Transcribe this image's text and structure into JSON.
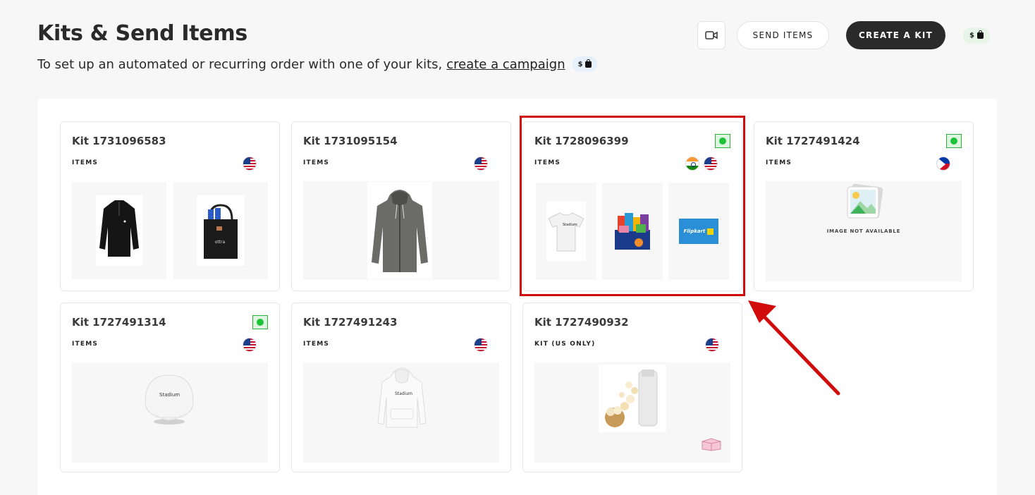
{
  "header": {
    "title": "Kits & Send Items",
    "subtitle": "To set up an automated or recurring order with one of your kits,",
    "subtitle_link": "create a campaign",
    "subtitle_badge": "$",
    "send_items_label": "SEND ITEMS",
    "create_kit_label": "CREATE A KIT",
    "balance_badge": "$"
  },
  "kits": [
    {
      "title": "Kit 1731096583",
      "label": "ITEMS",
      "flags": [
        "us"
      ],
      "status": false,
      "products": [
        "black-quarter-zip",
        "black-tote-bag"
      ]
    },
    {
      "title": "Kit 1731095154",
      "label": "ITEMS",
      "flags": [
        "us"
      ],
      "status": false,
      "products": [
        "grey-zip-hoodie"
      ]
    },
    {
      "title": "Kit 1728096399",
      "label": "ITEMS",
      "flags": [
        "in",
        "us"
      ],
      "status": true,
      "products": [
        "stadium-tshirt",
        "snack-box",
        "flipkart-gift-card"
      ]
    },
    {
      "title": "Kit 1727491424",
      "label": "ITEMS",
      "flags": [
        "ph"
      ],
      "status": true,
      "products": [
        "image-placeholder"
      ],
      "na_text": "IMAGE NOT AVAILABLE"
    },
    {
      "title": "Kit 1727491314",
      "label": "ITEMS",
      "flags": [
        "us"
      ],
      "status": true,
      "products": [
        "stadium-cap"
      ]
    },
    {
      "title": "Kit 1727491243",
      "label": "ITEMS",
      "flags": [
        "us"
      ],
      "status": false,
      "products": [
        "stadium-hoodie"
      ]
    },
    {
      "title": "Kit 1727490932",
      "label": "KIT (US ONLY)",
      "flags": [
        "us"
      ],
      "status": false,
      "products": [
        "popcorn-maker"
      ]
    }
  ],
  "product_text": {
    "brand": "Stadium",
    "tote": "ottra",
    "gift": "Flipkart"
  },
  "colors": {
    "accent_dark": "#2a2a2a",
    "status_green": "#1fc33a",
    "highlight_red": "#d10a0a"
  }
}
